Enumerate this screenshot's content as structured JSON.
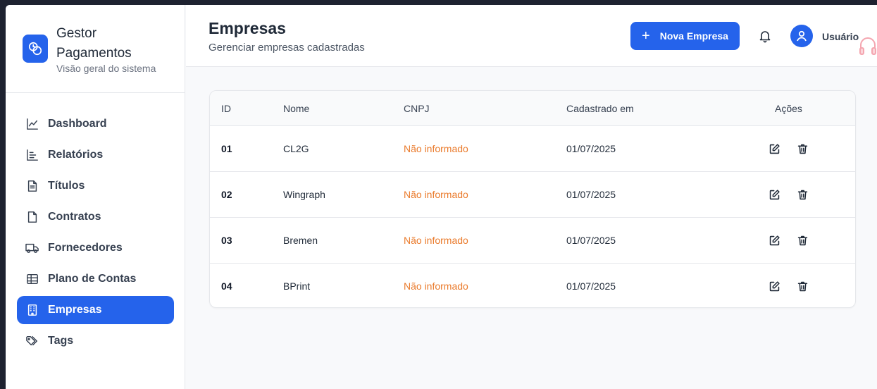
{
  "brand": {
    "title": "Gestor Pagamentos",
    "subtitle": "Visão geral do sistema"
  },
  "sidebar": {
    "items": [
      {
        "label": "Dashboard",
        "icon": "chart-line-icon",
        "active": false
      },
      {
        "label": "Relatórios",
        "icon": "bar-chart-icon",
        "active": false
      },
      {
        "label": "Títulos",
        "icon": "document-text-icon",
        "active": false
      },
      {
        "label": "Contratos",
        "icon": "document-icon",
        "active": false
      },
      {
        "label": "Fornecedores",
        "icon": "truck-icon",
        "active": false
      },
      {
        "label": "Plano de Contas",
        "icon": "table-icon",
        "active": false
      },
      {
        "label": "Empresas",
        "icon": "building-icon",
        "active": true
      },
      {
        "label": "Tags",
        "icon": "tag-icon",
        "active": false
      }
    ]
  },
  "header": {
    "title": "Empresas",
    "subtitle": "Gerenciar empresas cadastradas",
    "new_button_label": "Nova Empresa",
    "user_name": "Usuário"
  },
  "table": {
    "columns": [
      "ID",
      "Nome",
      "CNPJ",
      "Cadastrado em",
      "Ações"
    ],
    "rows": [
      {
        "id": "01",
        "name": "CL2G",
        "cnpj": "Não informado",
        "date": "01/07/2025"
      },
      {
        "id": "02",
        "name": "Wingraph",
        "cnpj": "Não informado",
        "date": "01/07/2025"
      },
      {
        "id": "03",
        "name": "Bremen",
        "cnpj": "Não informado",
        "date": "01/07/2025"
      },
      {
        "id": "04",
        "name": "BPrint",
        "cnpj": "Não informado",
        "date": "01/07/2025"
      }
    ]
  },
  "colors": {
    "accent": "#2563eb",
    "cnpj_missing": "#ea7a2b"
  }
}
